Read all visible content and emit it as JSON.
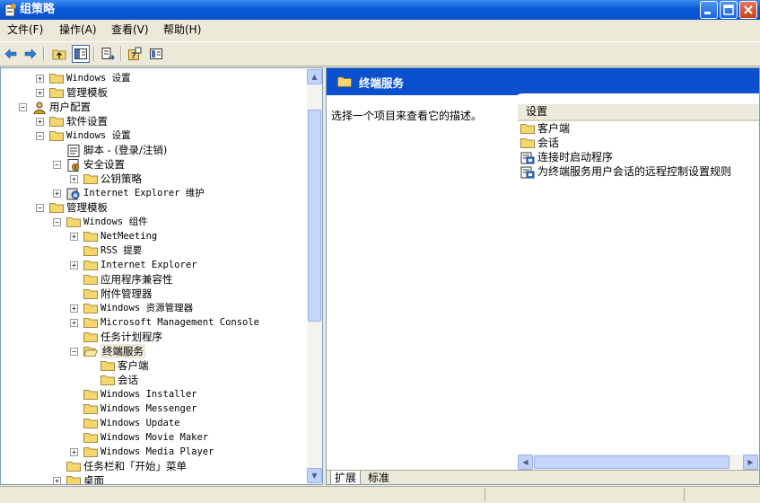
{
  "window": {
    "title": "组策略",
    "icon": "group-policy-icon",
    "controls": [
      "minimize-icon",
      "maximize-icon",
      "close-icon"
    ]
  },
  "menu": {
    "items": [
      "文件(F)",
      "操作(A)",
      "查看(V)",
      "帮助(H)"
    ]
  },
  "toolbar": {
    "buttons": [
      "back-arrow-icon",
      "forward-arrow-icon",
      "up-folder-icon",
      "show-hide-tree-icon",
      "export-list-icon",
      "help-icon",
      "properties-icon"
    ]
  },
  "tree": {
    "rows": [
      {
        "label": "Windows 设置",
        "expander": "+",
        "icon": "folder-icon"
      },
      {
        "label": "管理模板",
        "expander": "+",
        "icon": "folder-icon"
      },
      {
        "label": "用户配置",
        "expander": "−",
        "icon": "user-config-icon"
      },
      {
        "label": "软件设置",
        "expander": "+",
        "icon": "folder-icon"
      },
      {
        "label": "Windows 设置",
        "expander": "−",
        "icon": "folder-icon"
      },
      {
        "label": "脚本 - (登录/注销)",
        "expander": "",
        "icon": "script-icon"
      },
      {
        "label": "安全设置",
        "expander": "−",
        "icon": "security-settings-icon"
      },
      {
        "label": "公钥策略",
        "expander": "+",
        "icon": "folder-icon"
      },
      {
        "label": "Internet Explorer 维护",
        "expander": "+",
        "icon": "ie-maintenance-icon"
      },
      {
        "label": "管理模板",
        "expander": "−",
        "icon": "folder-icon"
      },
      {
        "label": "Windows 组件",
        "expander": "−",
        "icon": "folder-icon"
      },
      {
        "label": "NetMeeting",
        "expander": "+",
        "icon": "folder-icon"
      },
      {
        "label": "RSS 提要",
        "expander": "",
        "icon": "folder-icon"
      },
      {
        "label": "Internet Explorer",
        "expander": "+",
        "icon": "folder-icon"
      },
      {
        "label": "应用程序兼容性",
        "expander": "",
        "icon": "folder-icon"
      },
      {
        "label": "附件管理器",
        "expander": "",
        "icon": "folder-icon"
      },
      {
        "label": "Windows 资源管理器",
        "expander": "+",
        "icon": "folder-icon"
      },
      {
        "label": "Microsoft Management Console",
        "expander": "+",
        "icon": "folder-icon"
      },
      {
        "label": "任务计划程序",
        "expander": "",
        "icon": "folder-icon"
      },
      {
        "label": "终端服务",
        "expander": "−",
        "icon": "open-folder-icon"
      },
      {
        "label": "客户端",
        "expander": "",
        "icon": "folder-icon"
      },
      {
        "label": "会话",
        "expander": "",
        "icon": "folder-icon"
      },
      {
        "label": "Windows Installer",
        "expander": "",
        "icon": "folder-icon"
      },
      {
        "label": "Windows Messenger",
        "expander": "",
        "icon": "folder-icon"
      },
      {
        "label": "Windows Update",
        "expander": "",
        "icon": "folder-icon"
      },
      {
        "label": "Windows Movie Maker",
        "expander": "",
        "icon": "folder-icon"
      },
      {
        "label": "Windows Media Player",
        "expander": "+",
        "icon": "folder-icon"
      },
      {
        "label": "任务栏和「开始」菜单",
        "expander": "",
        "icon": "folder-icon"
      },
      {
        "label": "桌面",
        "expander": "+",
        "icon": "folder-icon"
      }
    ]
  },
  "details": {
    "header_title": "终端服务",
    "description_prompt": "选择一个项目来查看它的描述。",
    "column_header": "设置",
    "items": [
      {
        "label": "客户端",
        "icon": "folder-icon"
      },
      {
        "label": "会话",
        "icon": "folder-icon"
      },
      {
        "label": "连接时启动程序",
        "icon": "policy-setting-icon"
      },
      {
        "label": "为终端服务用户会话的远程控制设置规则",
        "icon": "policy-setting-icon"
      }
    ]
  },
  "tabs": [
    "扩展",
    "标准"
  ],
  "colors": {
    "title_bar": "#0a5ad8",
    "details_header": "#0a50cf",
    "folder": "#f5d76e",
    "window_bg": "#ece9d8"
  }
}
